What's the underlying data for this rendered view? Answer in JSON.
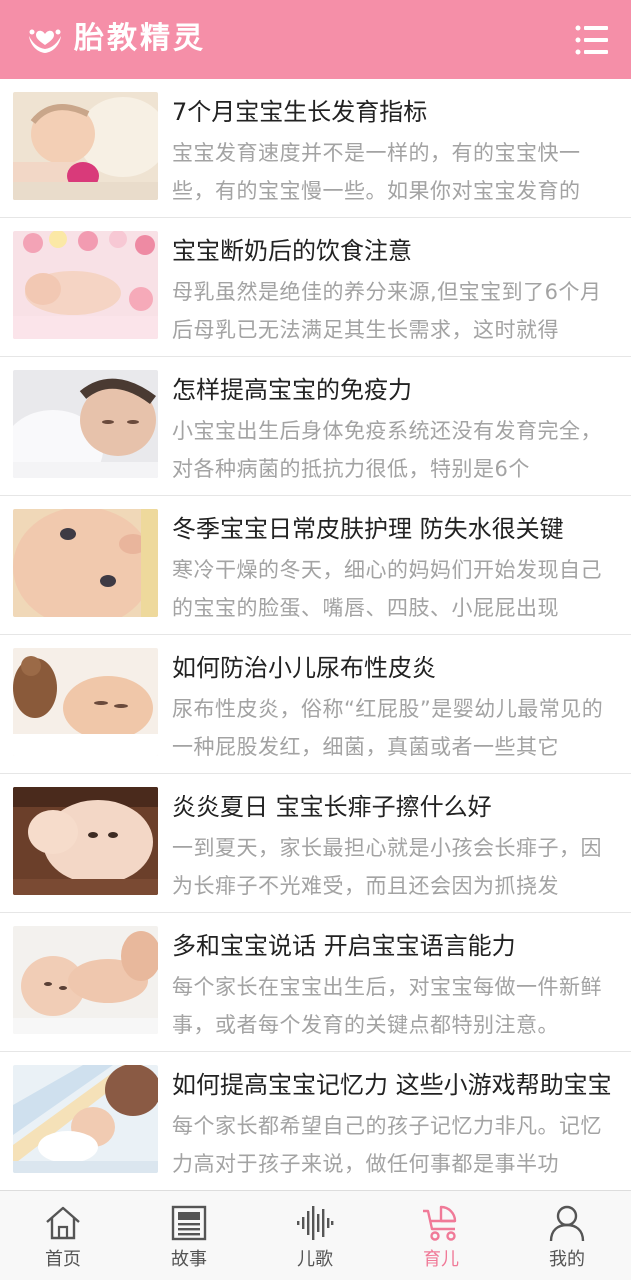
{
  "header": {
    "title": "胎教精灵",
    "logo_icon": "hands-heart-logo",
    "menu_icon": "list-menu-icon"
  },
  "articles": [
    {
      "title": "7个月宝宝生长发育指标",
      "summary": "宝宝发育速度并不是一样的，有的宝宝快一些，有的宝宝慢一些。如果你对宝宝发育的"
    },
    {
      "title": "宝宝断奶后的饮食注意",
      "summary": "母乳虽然是绝佳的养分来源,但宝宝到了6个月后母乳已无法满足其生长需求，这时就得"
    },
    {
      "title": "怎样提高宝宝的免疫力",
      "summary": "小宝宝出生后身体免疫系统还没有发育完全，对各种病菌的抵抗力很低，特别是6个"
    },
    {
      "title": "冬季宝宝日常皮肤护理 防失水很关键",
      "summary": "寒冷干燥的冬天，细心的妈妈们开始发现自己的宝宝的脸蛋、嘴唇、四肢、小屁屁出现"
    },
    {
      "title": "如何防治小儿尿布性皮炎",
      "summary": "尿布性皮炎，俗称“红屁股”是婴幼儿最常见的一种屁股发红，细菌，真菌或者一些其它"
    },
    {
      "title": "炎炎夏日 宝宝长痱子擦什么好",
      "summary": "一到夏天，家长最担心就是小孩会长痱子，因为长痱子不光难受，而且还会因为抓挠发"
    },
    {
      "title": "多和宝宝说话 开启宝宝语言能力",
      "summary": "每个家长在宝宝出生后，对宝宝每做一件新鲜事，或者每个发育的关键点都特别注意。"
    },
    {
      "title": "如何提高宝宝记忆力 这些小游戏帮助宝宝",
      "summary": "每个家长都希望自己的孩子记忆力非凡。记忆力高对于孩子来说，做任何事都是事半功"
    }
  ],
  "tabs": [
    {
      "label": "首页",
      "icon": "home-icon",
      "active": false
    },
    {
      "label": "故事",
      "icon": "newspaper-icon",
      "active": false
    },
    {
      "label": "儿歌",
      "icon": "sound-wave-icon",
      "active": false
    },
    {
      "label": "育儿",
      "icon": "baby-stroller-icon",
      "active": true
    },
    {
      "label": "我的",
      "icon": "user-icon",
      "active": false
    }
  ],
  "colors": {
    "brand": "#f58fa8",
    "active_tab": "#f07a98",
    "inactive_tab": "#555555",
    "summary_text": "#a3a3a3"
  }
}
